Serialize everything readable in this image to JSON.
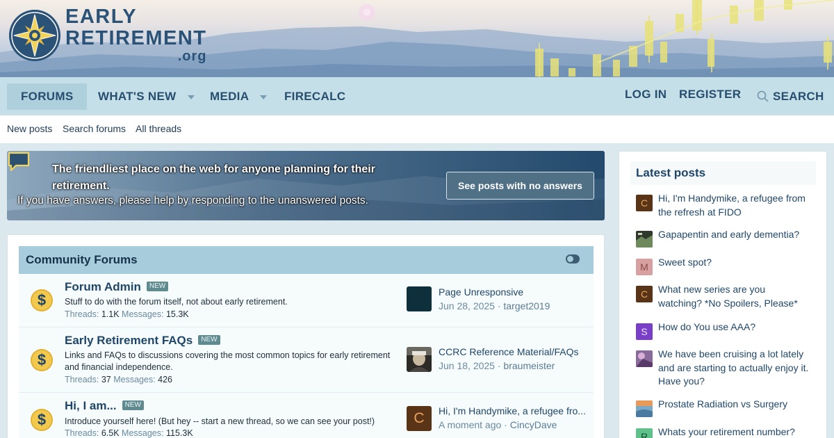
{
  "site": {
    "logo_line1": "EARLY",
    "logo_line2": "RETIREMENT",
    "logo_line3": ".org",
    "logo_icon": "compass-star-icon",
    "brand_color": "#2b5277"
  },
  "nav": {
    "items": [
      {
        "label": "FORUMS",
        "active": true
      },
      {
        "label": "WHAT'S NEW",
        "has_dropdown": true
      },
      {
        "label": "MEDIA",
        "has_dropdown": true
      },
      {
        "label": "FIRECALC"
      }
    ],
    "login": "LOG IN",
    "register": "REGISTER",
    "search": "SEARCH",
    "search_icon": "search-icon"
  },
  "subnav": {
    "items": [
      "New posts",
      "Search forums",
      "All threads"
    ]
  },
  "notice": {
    "title": "The friendliest place on the web for anyone planning for their retirement.",
    "subtitle": "If you have answers, please help by responding to the unanswered posts.",
    "button": "See posts with no answers",
    "icon": "speech-bubble-icon"
  },
  "category": {
    "title": "Community Forums",
    "toggle_icon": "collapse-toggle-icon"
  },
  "forums": [
    {
      "title": "Forum Admin",
      "badge": "NEW",
      "description": "Stuff to do with the forum itself, not about early retirement.",
      "threads_label": "Threads:",
      "threads": "1.1K",
      "messages_label": "Messages:",
      "messages": "15.3K",
      "last_title": "Page Unresponsive",
      "last_date": "Jun 28, 2025",
      "last_user": "target2019",
      "icon": "dollar-coin-icon"
    },
    {
      "title": "Early Retirement FAQs",
      "badge": "NEW",
      "description": "Links and FAQs to discussions covering the most common topics for early retirement and financial independence.",
      "threads_label": "Threads:",
      "threads": "37",
      "messages_label": "Messages:",
      "messages": "426",
      "last_title": "CCRC Reference Material/FAQs",
      "last_date": "Jun 18, 2025",
      "last_user": "braumeister",
      "icon": "dollar-coin-icon"
    },
    {
      "title": "Hi, I am...",
      "badge": "NEW",
      "description": "Introduce yourself here! (But hey -- start a new thread, so we can see your post!)",
      "threads_label": "Threads:",
      "threads": "6.5K",
      "messages_label": "Messages:",
      "messages": "115.3K",
      "last_title": "Hi, I'm Handymike, a refugee fro...",
      "last_date": "A moment ago",
      "last_user": "CincyDave",
      "last_avatar_letter": "C",
      "icon": "dollar-coin-icon"
    }
  ],
  "sidebar": {
    "title": "Latest posts",
    "posts": [
      {
        "title": "Hi, I'm Handymike, a refugee from the refresh at FIDO",
        "avatar_letter": "C",
        "avatar_color": "#5a3417",
        "letter_color": "#e8a35c"
      },
      {
        "title": "Gapapentin and early dementia?",
        "avatar_letter": "",
        "avatar_color": "#3c5a3a",
        "letter_color": "#ffffff"
      },
      {
        "title": "Sweet spot?",
        "avatar_letter": "M",
        "avatar_color": "#d7a1a1",
        "letter_color": "#8a4a4a"
      },
      {
        "title": "What new series are you watching? *No Spoilers, Please*",
        "avatar_letter": "C",
        "avatar_color": "#5a3417",
        "letter_color": "#e8a35c"
      },
      {
        "title": "How do You use AAA?",
        "avatar_letter": "S",
        "avatar_color": "#7a3fc8",
        "letter_color": "#f1e6ff"
      },
      {
        "title": "We have been cruising a lot lately and are starting to actually enjoy it. Have you?",
        "avatar_letter": "",
        "avatar_color": "#9a6a9a",
        "letter_color": "#ffffff"
      },
      {
        "title": "Prostate Radiation vs Surgery",
        "avatar_letter": "",
        "avatar_color": "#7aaac8",
        "letter_color": "#ffffff"
      },
      {
        "title": "Whats your retirement number?",
        "avatar_letter": "R",
        "avatar_color": "#5fc28a",
        "letter_color": "#0e4a2a"
      }
    ]
  }
}
